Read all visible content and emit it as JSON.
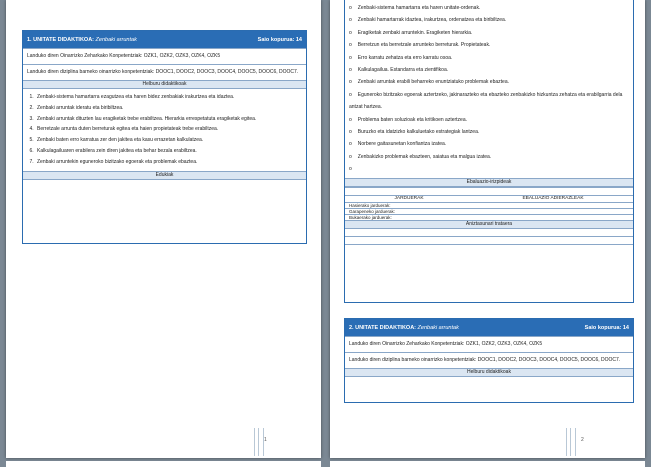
{
  "unit1": {
    "header_left": "1.  UNITATE DIDAKTIKOA:",
    "header_topic": "Zenbaki arruntak",
    "header_right": "Saio kopurua:  14",
    "competences_key": "Landuko diren Oinarrizko Zeharkako Konpetentziak:   OZK1, OZK2, OZK3, OZK4, OZK5",
    "competences_subject": "Landuko diren diziplina barneko oinarrizko konpetentziak:   DOOC1, DOOC2, DOOC3, DOOC4, DOOC5, DOOC6, DOOC7.",
    "objectives_title": "Helburu didaktikoak",
    "objectives": [
      "Zenbaki-sistema  hamartarra  ezagutzea  eta haren  bidez  zenbakiak  irakurtzea  eta idaztea.",
      "Zenbaki  arruntak  ideratu  eta biribiltzea.",
      "Zenbaki  arruntak  dituzten lau eragiketak  trebe erabiltzea.  Hierarkia  errespetatuta  eragiketak egitea.",
      "Berretzale  arrunta  duten berreturak  egitea  eta haien  propietateak  trebe erabiltzea.",
      "Zenbaki  baten  erro karratua  zer den  jakitea  eta kasu  errazetan  kalkulatzea.",
      "Kalkulagailuaren   erabilera  zein  diren jakitea  eta behar  bezala  erabiltzea.",
      "Zenbaki  arruntekin  eguneroko  bizitzako  egoerak  eta problemak  ebaztea."
    ],
    "contents_title": "Edukiak"
  },
  "page2": {
    "contents": [
      "Zenbaki-sistema   hamartarra  eta haren  unitate-ordenak.",
      "Zenbaki  hamartarrak  idaztea,  irakurtzea,  ordenatzea  eta biribiltzea.",
      "Eragiketak  zenbaki  arruntekin.   Eragiketen  hierarkia.",
      "Berretzun  eta berretzale  arrunteko  berreturak.  Propietateak.",
      "Erro karratu  zehatza  eta erro karratu osoa.",
      "Kalkulagailua.   Estandarra  eta zientifikoa.",
      "Zenbaki  arruntak  erabili  beharreko  enuntziatuko  problemak  ebaztea.",
      "Eguneroko  bizitzako  egoerak  aztertzeko,  jakinarazteko  eta ebazteko  zenbakizko  hizkuntza zehatza eta erabilgarria   dela  antzat  hartzea.",
      "Problema  baten  soluzioak  eta kritikoen  aztertzea.",
      "Buruzko  eta idatzizko  kalkuluetako  estrategiak  lantzea.",
      "Norbere  gaitasunetan  konfiantza  izatea.",
      "Zenbakizko  problemak  ebazteen,  saiatua  eta malgua  izatea.",
      ""
    ],
    "eval_title": "Ebaluazio-irizpideak",
    "col_activities": "JARDUERAK",
    "col_eval": "EBALUAZIO  ADIERAZLEAK",
    "activity_rows": [
      "Hasierako   jarduerak:",
      "Garapeneko  jarduerak:",
      "Bukaerako   jarduerak:"
    ],
    "notes_title": "Aniztasunari   trataera"
  },
  "unit2": {
    "header_left": "2.  UNITATE DIDAKTIKOA:",
    "header_topic": "Zenbaki arruntak",
    "header_right": "Saio kopurua:  14",
    "competences_key": "Landuko diren Oinarrizko Zeharkako Konpetentziak:   OZK1, OZK2, OZK3, OZK4, OZK5",
    "competences_subject": "Landuko diren diziplina barneko oinarrizko konpetentziak:   DOOC1, DOOC2, DOOC3, DOOC4, DOOC5, DOOC6, DOOC7.",
    "objectives_title": "Helburu didaktikoak"
  },
  "page_numbers": [
    "1",
    "2"
  ]
}
